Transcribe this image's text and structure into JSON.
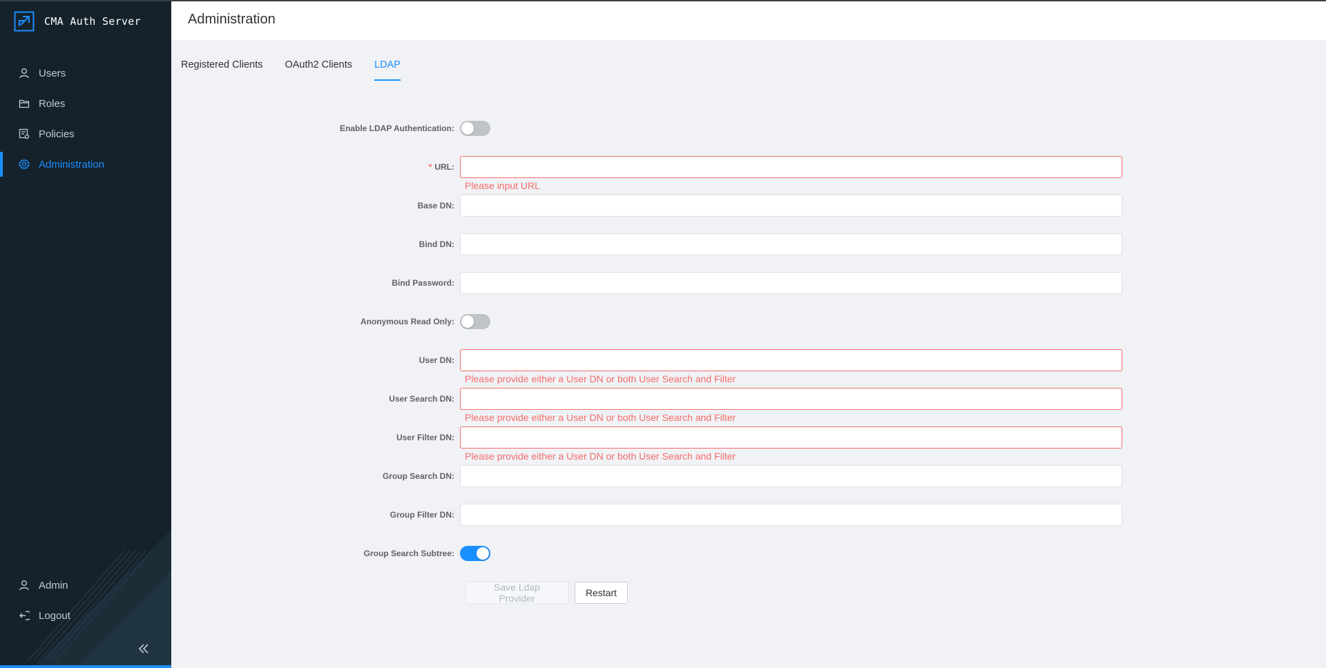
{
  "app": {
    "title": "CMA Auth Server"
  },
  "sidebar": {
    "items": [
      {
        "label": "Users",
        "icon": "user-icon",
        "active": false
      },
      {
        "label": "Roles",
        "icon": "folder-icon",
        "active": false
      },
      {
        "label": "Policies",
        "icon": "policy-icon",
        "active": false
      },
      {
        "label": "Administration",
        "icon": "gear-icon",
        "active": true
      }
    ],
    "bottom_items": [
      {
        "label": "Admin",
        "icon": "user-icon"
      },
      {
        "label": "Logout",
        "icon": "logout-icon"
      }
    ],
    "collapse_icon": "double-chevron-left-icon"
  },
  "header": {
    "title": "Administration"
  },
  "tabs": [
    {
      "label": "Registered Clients",
      "active": false
    },
    {
      "label": "OAuth2 Clients",
      "active": false
    },
    {
      "label": "LDAP",
      "active": true
    }
  ],
  "form": {
    "enable_ldap": {
      "label": "Enable LDAP Authentication",
      "value": false
    },
    "url": {
      "label": "URL",
      "required": true,
      "value": "",
      "error": "Please input URL"
    },
    "base_dn": {
      "label": "Base DN",
      "value": ""
    },
    "bind_dn": {
      "label": "Bind DN",
      "value": ""
    },
    "bind_password": {
      "label": "Bind Password",
      "value": ""
    },
    "anonymous_read_only": {
      "label": "Anonymous Read Only",
      "value": false
    },
    "user_dn": {
      "label": "User DN",
      "value": "",
      "error": "Please provide either a User DN or both User Search and Filter"
    },
    "user_search_dn": {
      "label": "User Search DN",
      "value": "",
      "error": "Please provide either a User DN or both User Search and Filter"
    },
    "user_filter_dn": {
      "label": "User Filter DN",
      "value": "",
      "error": "Please provide either a User DN or both User Search and Filter"
    },
    "group_search_dn": {
      "label": "Group Search DN",
      "value": ""
    },
    "group_filter_dn": {
      "label": "Group Filter DN",
      "value": ""
    },
    "group_search_subtree": {
      "label": "Group Search Subtree",
      "value": true
    },
    "save_button": {
      "label": "Save Ldap Provider",
      "disabled": true
    },
    "restart_button": {
      "label": "Restart"
    }
  },
  "colors": {
    "accent": "#1a8fff",
    "error": "#f56c6c",
    "sidebar_bg": "#15222c",
    "content_bg": "#f0f2f5"
  }
}
